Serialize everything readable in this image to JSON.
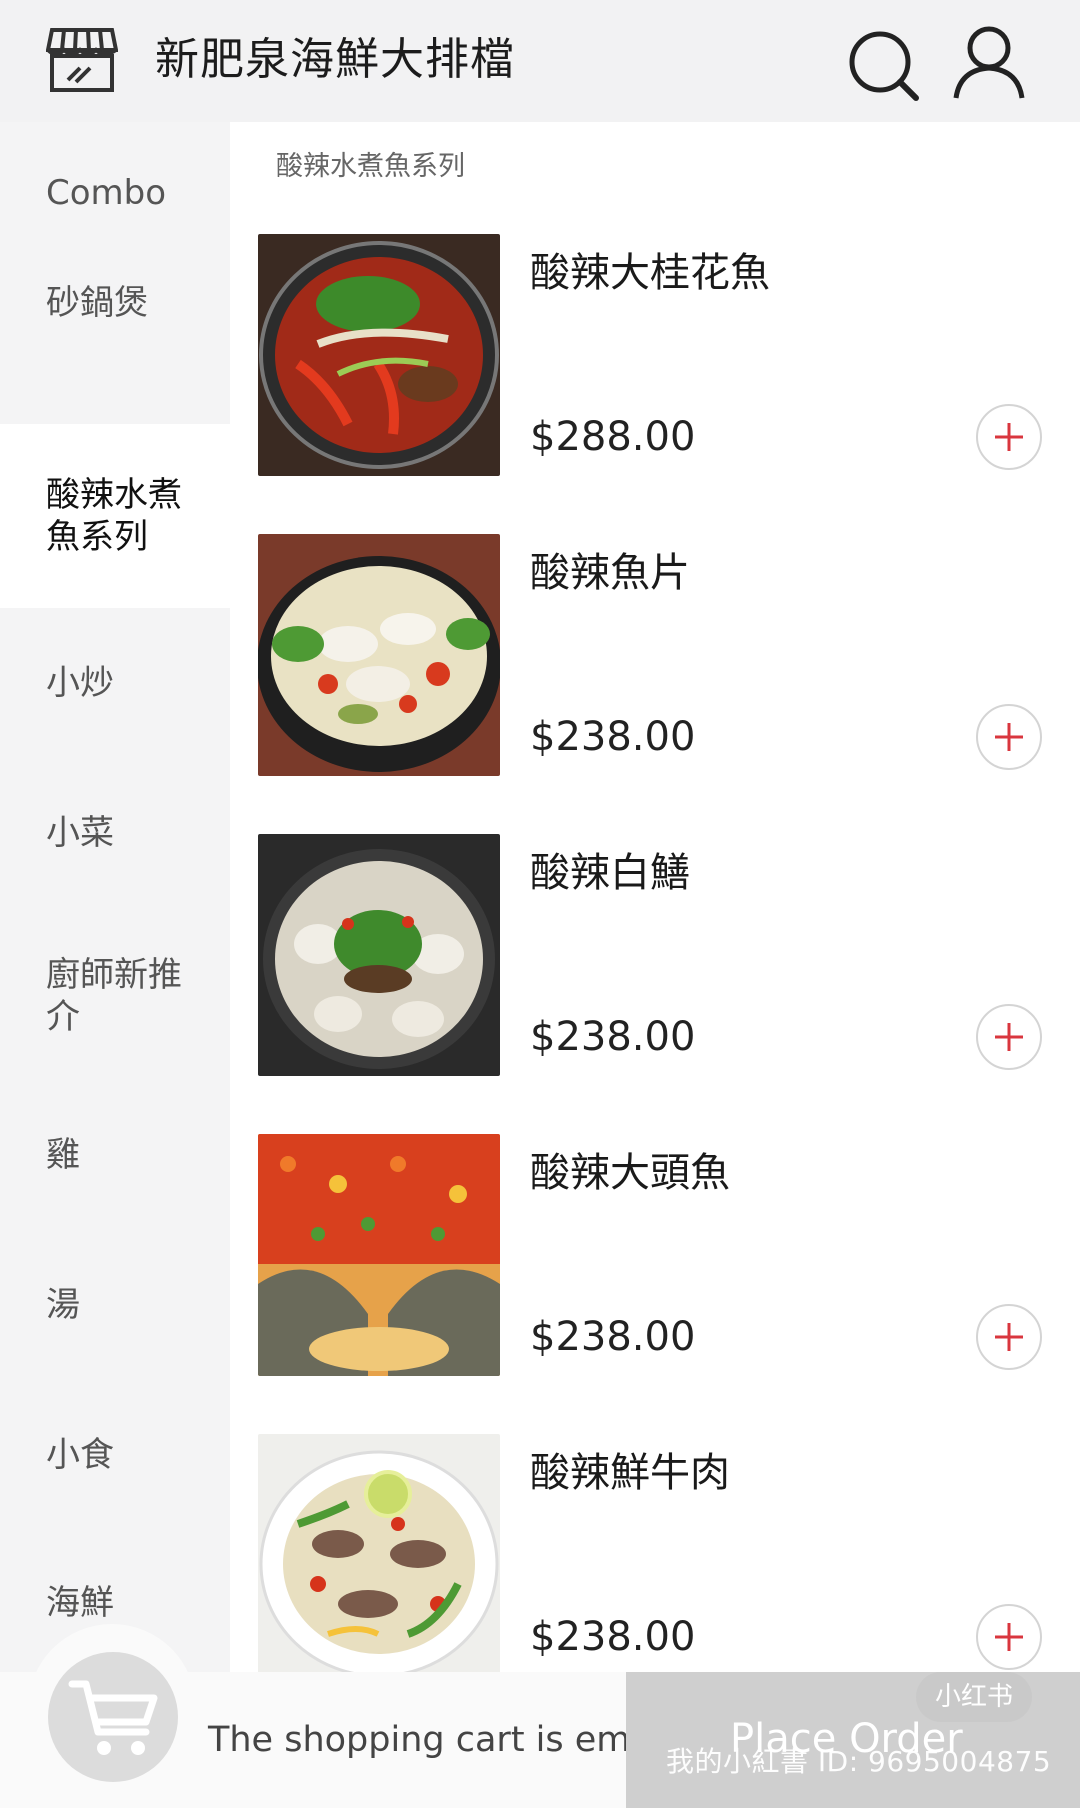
{
  "header": {
    "title": "新肥泉海鮮大排檔",
    "icons": [
      "store-icon",
      "search-icon",
      "user-icon"
    ]
  },
  "sidebar": {
    "items": [
      {
        "label": "Combo"
      },
      {
        "label": "砂鍋煲"
      },
      {
        "label": "酸辣水煮魚系列",
        "active": true
      },
      {
        "label": "小炒"
      },
      {
        "label": "小菜"
      },
      {
        "label": "廚師新推介"
      },
      {
        "label": "雞"
      },
      {
        "label": "湯"
      },
      {
        "label": "小食"
      },
      {
        "label": "海鮮"
      }
    ]
  },
  "main": {
    "section_title": "酸辣水煮魚系列",
    "dishes": [
      {
        "name": "酸辣大桂花魚",
        "price": "$288.00"
      },
      {
        "name": "酸辣魚片",
        "price": "$238.00"
      },
      {
        "name": "酸辣白鱔",
        "price": "$238.00"
      },
      {
        "name": "酸辣大頭魚",
        "price": "$238.00"
      },
      {
        "name": "酸辣鮮牛肉",
        "price": "$238.00"
      }
    ]
  },
  "cart": {
    "empty_text": "The shopping cart is empty",
    "order_label": "Place Order"
  },
  "watermark": {
    "logo": "小红书",
    "text": "我的小紅書 ID: 9695004875"
  },
  "colors": {
    "add_icon": "#d9363e",
    "order_button": "#cfcfcf"
  }
}
